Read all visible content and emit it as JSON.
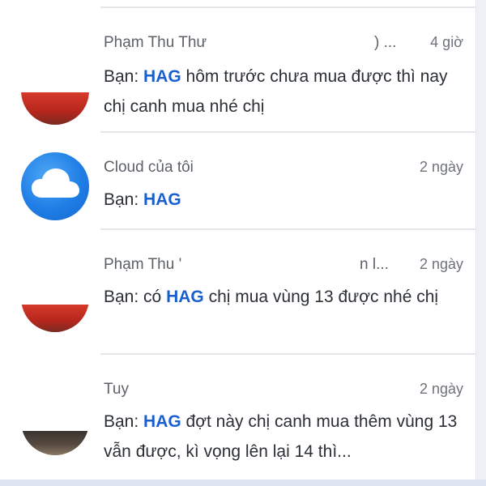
{
  "conversations": [
    {
      "name": "Phạm Thu Thư",
      "name_trail": ") ...",
      "time": "4 giờ",
      "prefix": "Bạn: ",
      "highlight": "HAG",
      "message_rest": " hôm trước chưa mua được thì nay chị canh mua nhé chị",
      "avatar_icon": "user-photo"
    },
    {
      "name": "Cloud của tôi",
      "time": "2 ngày",
      "prefix": "Bạn: ",
      "highlight": "HAG",
      "message_rest": "",
      "avatar_icon": "cloud-icon"
    },
    {
      "name": "Phạm Thu '",
      "name_trail": "n l...",
      "time": "2 ngày",
      "prefix": "Bạn: có ",
      "highlight": "HAG",
      "message_rest": " chị mua vùng 13 được nhé chị",
      "avatar_icon": "user-photo"
    },
    {
      "name": "Tuy",
      "time": "2 ngày",
      "prefix": "Bạn: ",
      "highlight": "HAG",
      "message_rest": " đợt này chị canh mua thêm vùng 13 vẫn được, kì vọng lên lại 14 thì...",
      "avatar_icon": "user-photo"
    }
  ],
  "colors": {
    "highlight": "#1a5fd0",
    "name": "#5d6168",
    "message": "#2b2f36"
  }
}
